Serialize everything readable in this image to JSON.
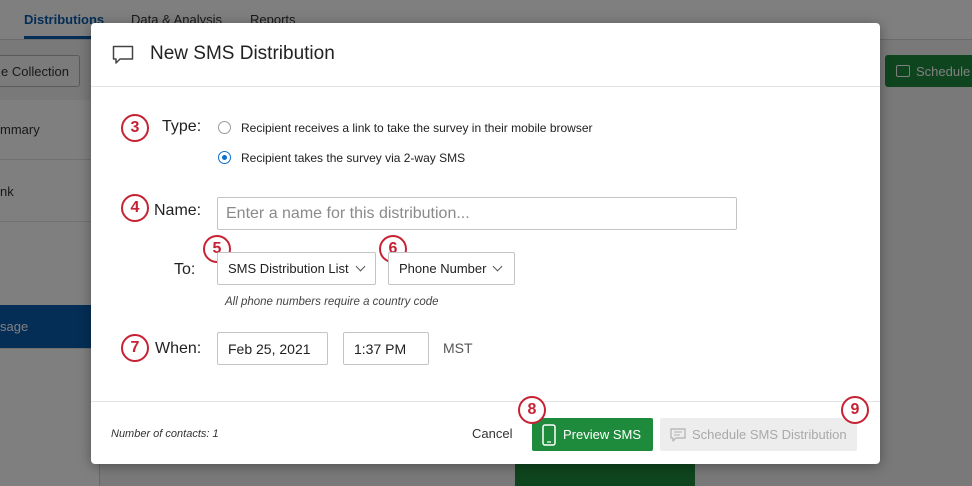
{
  "background": {
    "tabs": [
      "Distributions",
      "Data & Analysis",
      "Reports"
    ],
    "left_button_label": "e Collection",
    "right_button_label": "Schedule",
    "sidebar_items": [
      "mmary",
      "nk",
      "",
      "sage"
    ]
  },
  "modal": {
    "title": "New SMS Distribution",
    "icon": "speech-bubble-icon",
    "type_label": "Type:",
    "type_options": [
      {
        "label": "Recipient receives a link to take the survey in their mobile browser",
        "selected": false
      },
      {
        "label": "Recipient takes the survey via 2-way SMS",
        "selected": true
      }
    ],
    "name_label": "Name:",
    "name_placeholder": "Enter a name for this distribution...",
    "to_label": "To:",
    "to_list_value": "SMS Distribution List",
    "to_field_value": "Phone Number",
    "to_hint": "All phone numbers require a country code",
    "when_label": "When:",
    "date_value": "Feb 25, 2021",
    "time_value": "1:37 PM",
    "timezone": "MST",
    "contacts_text": "Number of contacts: 1",
    "cancel_label": "Cancel",
    "preview_label": "Preview SMS",
    "schedule_label": "Schedule SMS Distribution"
  },
  "callouts": [
    "3",
    "4",
    "5",
    "6",
    "7",
    "8",
    "9"
  ],
  "colors": {
    "accent_green": "#1e8a3c",
    "callout_red": "#c62233",
    "radio_blue": "#0b6ed0",
    "brand_blue": "#0b5cad"
  }
}
